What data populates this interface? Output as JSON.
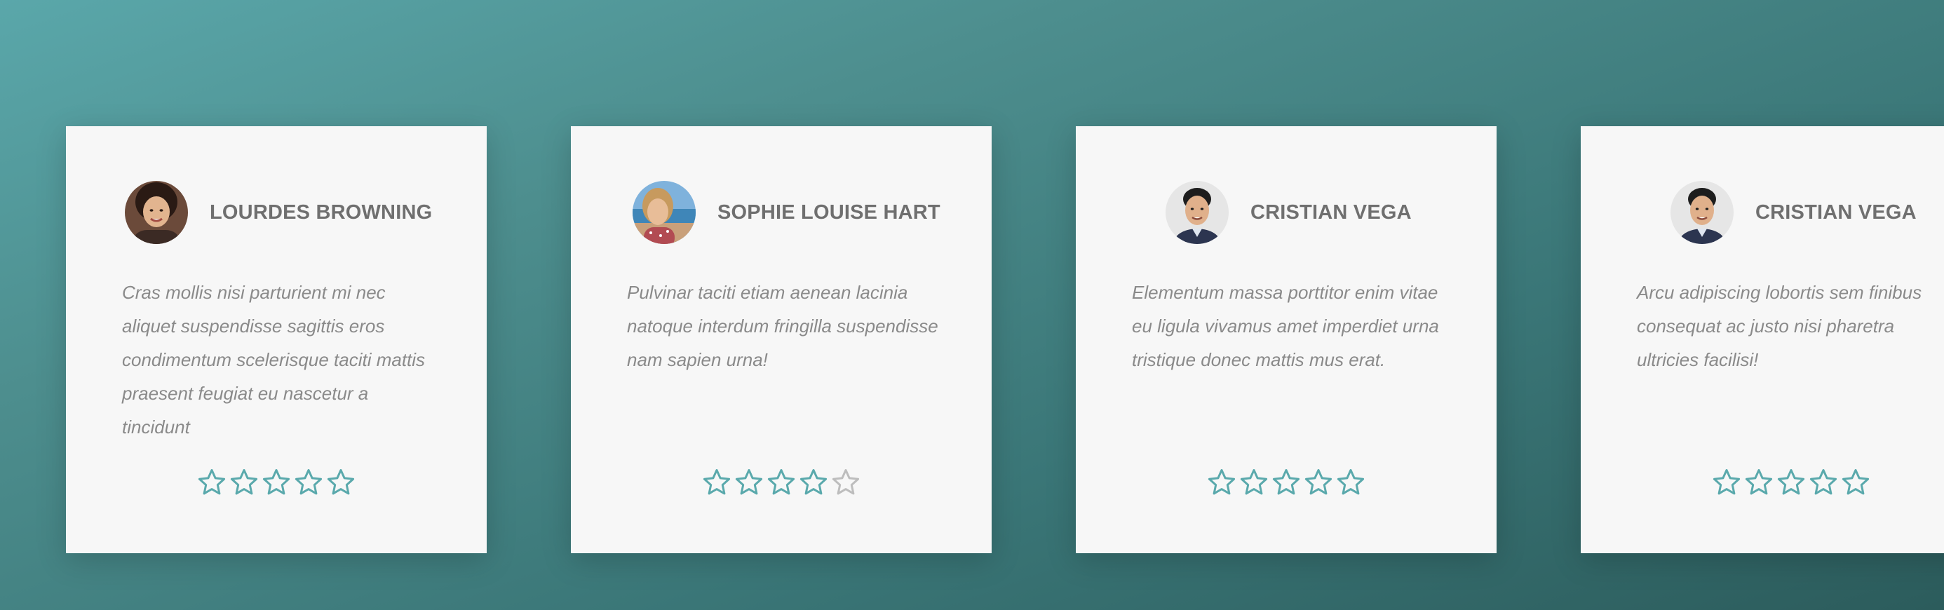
{
  "colors": {
    "star_filled": "#5aa9ac",
    "star_empty": "#bdbdbd",
    "card_bg": "#f7f7f7",
    "name_text": "#6f6f6f",
    "quote_text": "#8a8a8a"
  },
  "testimonials": [
    {
      "name": "LOURDES BROWNING",
      "avatar": "woman-portrait-avatar",
      "quote": "Cras mollis nisi parturient mi nec aliquet suspendisse sagittis eros condimentum scelerisque taciti mattis praesent feugiat eu nascetur a tincidunt",
      "rating": 5,
      "max_rating": 5
    },
    {
      "name": "SOPHIE LOUISE HART",
      "avatar": "woman-beach-avatar",
      "quote": "Pulvinar taciti etiam aenean lacinia natoque interdum fringilla suspendisse nam sapien urna!",
      "rating": 4,
      "max_rating": 5
    },
    {
      "name": "CRISTIAN VEGA",
      "avatar": "man-portrait-avatar",
      "quote": "Elementum massa porttitor enim vitae eu ligula vivamus amet imperdiet urna tristique donec mattis mus erat.",
      "rating": 5,
      "max_rating": 5
    },
    {
      "name": "CRISTIAN VEGA",
      "avatar": "man-portrait-avatar",
      "quote": "Arcu adipiscing lobortis sem finibus consequat ac justo nisi pharetra ultricies facilisi!",
      "rating": 5,
      "max_rating": 5
    }
  ]
}
